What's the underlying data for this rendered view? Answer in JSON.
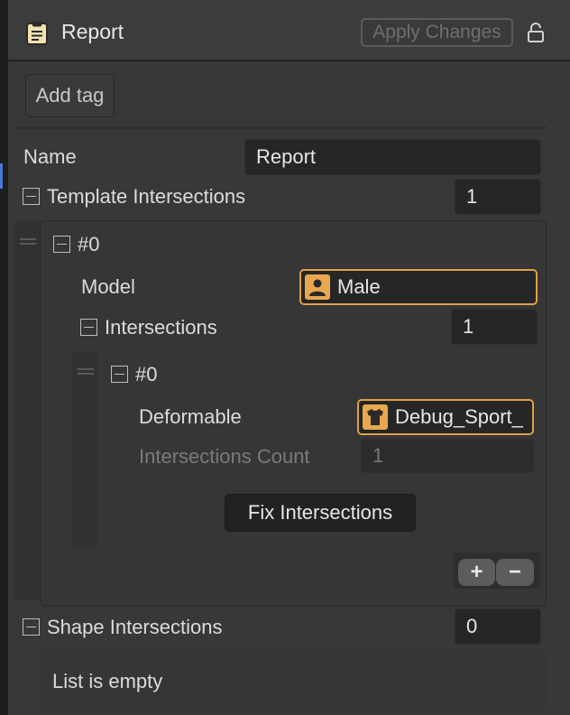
{
  "header": {
    "title": "Report",
    "apply_label": "Apply Changes"
  },
  "tags": {
    "add_label": "Add tag"
  },
  "name_field": {
    "label": "Name",
    "value": "Report"
  },
  "template_intersections": {
    "label": "Template Intersections",
    "count": "1",
    "elements": [
      {
        "index": "#0",
        "model_label": "Model",
        "model_value": "Male",
        "model_icon": "person-icon",
        "intersections_label": "Intersections",
        "intersections_count": "1",
        "intersections": [
          {
            "index": "#0",
            "deformable_label": "Deformable",
            "deformable_value": "Debug_Sport_",
            "deformable_icon": "shirt-icon",
            "count_label": "Intersections Count",
            "count_value": "1",
            "fix_label": "Fix Intersections"
          }
        ]
      }
    ],
    "add_symbol": "+",
    "remove_symbol": "−"
  },
  "shape_intersections": {
    "label": "Shape Intersections",
    "count": "0",
    "empty_text": "List is empty"
  },
  "colors": {
    "background": "#383838",
    "panel": "#323232",
    "field": "#262626",
    "accent": "#e0a04a",
    "selection_marker": "#4a78d8"
  }
}
